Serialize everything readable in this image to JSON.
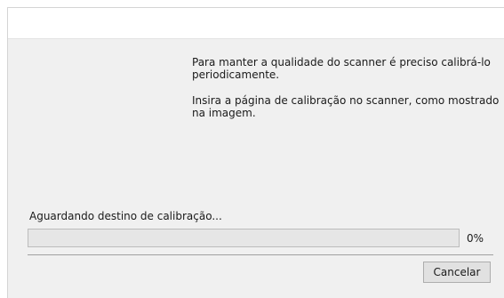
{
  "message": {
    "paragraph1": "Para manter a qualidade do scanner é preciso calibrá-lo periodicamente.",
    "paragraph2": "Insira a página de calibração no scanner, como mostrado na imagem."
  },
  "status": {
    "text": "Aguardando destino de calibração...",
    "progress": 0,
    "percent_label": "0%"
  },
  "buttons": {
    "cancel_label": "Cancelar"
  },
  "colors": {
    "content_background": "#f0f0f0",
    "progress_fill": "#06b025"
  }
}
